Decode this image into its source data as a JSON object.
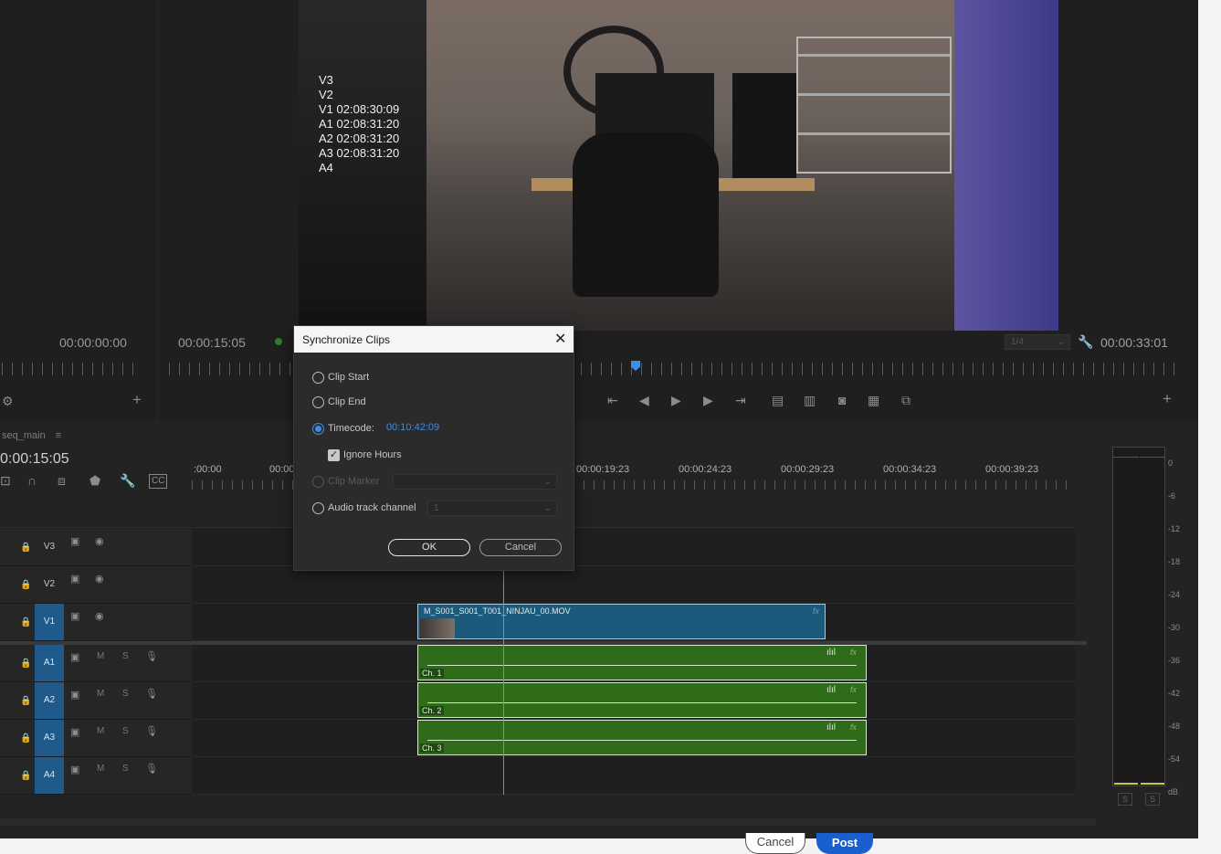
{
  "source_monitor": {
    "timecode": "00:00:00:00"
  },
  "program_monitor": {
    "timecode_left": "00:00:15:05",
    "timecode_right": "00:00:33:01",
    "resolution": "1/4",
    "overlay": [
      "V3",
      "V2",
      "V1 02:08:30:09",
      "A1 02:08:31:20",
      "A2 02:08:31:20",
      "A3 02:08:31:20",
      "A4"
    ]
  },
  "timeline": {
    "sequence_name": "seq_main",
    "playhead_timecode": "0:00:15:05",
    "ruler_labels": [
      ":00:00",
      "00:00",
      "00:00:19:23",
      "00:00:24:23",
      "00:00:29:23",
      "00:00:34:23",
      "00:00:39:23"
    ],
    "tracks": [
      {
        "id": "v3",
        "label": "V3",
        "type": "video",
        "active": false
      },
      {
        "id": "v2",
        "label": "V2",
        "type": "video",
        "active": false
      },
      {
        "id": "v1",
        "label": "V1",
        "type": "video",
        "active": true
      },
      {
        "id": "a1",
        "label": "A1",
        "type": "audio",
        "active": true
      },
      {
        "id": "a2",
        "label": "A2",
        "type": "audio",
        "active": true
      },
      {
        "id": "a3",
        "label": "A3",
        "type": "audio",
        "active": true
      },
      {
        "id": "a4",
        "label": "A4",
        "type": "audio",
        "active": true
      }
    ],
    "mute_label": "M",
    "solo_label": "S",
    "video_clip": {
      "name": "M_S001_S001_T001_NINJAU_00.MOV",
      "fx": "fx"
    },
    "audio_clips": [
      {
        "label": "Ch. 1"
      },
      {
        "label": "Ch. 2"
      },
      {
        "label": "Ch. 3"
      }
    ]
  },
  "meter": {
    "scale": [
      "0",
      "-6",
      "-12",
      "-18",
      "-24",
      "-30",
      "-36",
      "-42",
      "-48",
      "-54",
      "dB"
    ],
    "solo_buttons": [
      "S",
      "S"
    ]
  },
  "dialog": {
    "title": "Synchronize Clips",
    "options": {
      "clip_start": "Clip Start",
      "clip_end": "Clip End",
      "timecode": "Timecode:",
      "timecode_value": "00:10:42:09",
      "ignore_hours": "Ignore Hours",
      "clip_marker": "Clip Marker",
      "audio_track_channel": "Audio track channel",
      "audio_channel_value": "1"
    },
    "ok_label": "OK",
    "cancel_label": "Cancel"
  },
  "background_page": {
    "cancel_label": "Cancel",
    "post_label": "Post"
  }
}
